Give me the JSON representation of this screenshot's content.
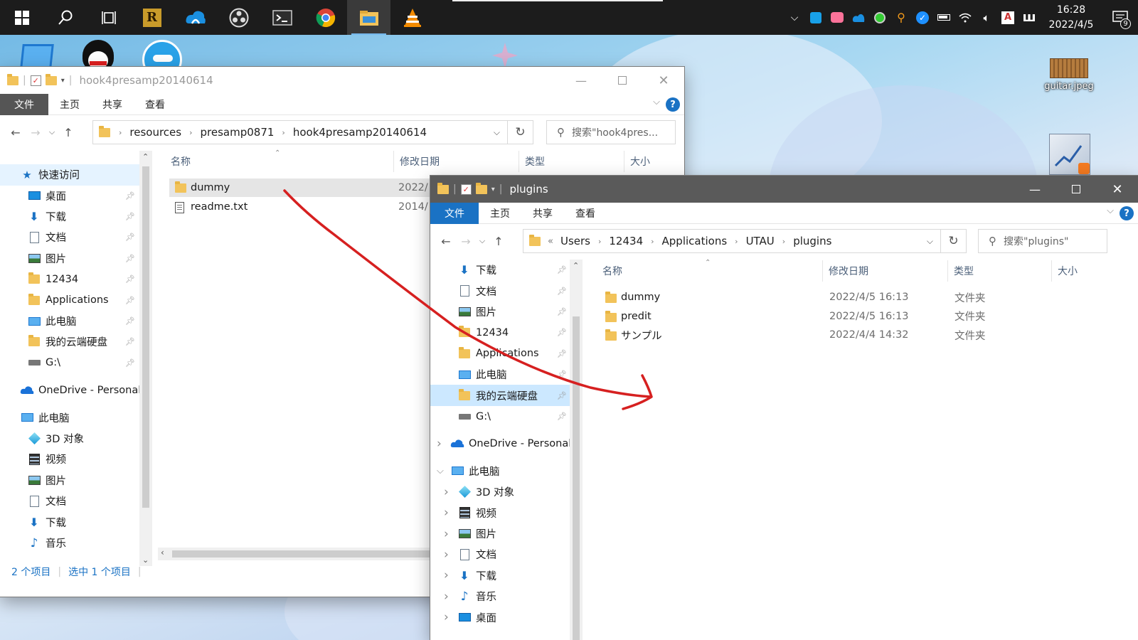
{
  "taskbar": {
    "apps": [
      {
        "name": "start",
        "icon": "windows-start-icon"
      },
      {
        "name": "search",
        "icon": "search-icon"
      },
      {
        "name": "task-view",
        "icon": "task-view-icon"
      },
      {
        "name": "r-app",
        "icon": "r-app-icon"
      },
      {
        "name": "cloud-app",
        "icon": "cloud-app-icon"
      },
      {
        "name": "obs",
        "icon": "obs-icon"
      },
      {
        "name": "terminal",
        "icon": "terminal-icon"
      },
      {
        "name": "chrome",
        "icon": "chrome-icon"
      },
      {
        "name": "file-explorer",
        "icon": "file-explorer-icon"
      },
      {
        "name": "vlc",
        "icon": "vlc-icon"
      }
    ],
    "clock_time": "16:28",
    "clock_date": "2022/4/5",
    "notif_count": "9"
  },
  "desktop": {
    "icons": [
      {
        "label": "guitar.jpeg"
      }
    ]
  },
  "window1": {
    "title": "hook4presamp20140614",
    "tabs": [
      "文件",
      "主页",
      "共享",
      "查看"
    ],
    "address": [
      "resources",
      "presamp0871",
      "hook4presamp20140614"
    ],
    "search_placeholder": "搜索\"hook4pres...",
    "nav": [
      {
        "label": "快速访问",
        "icon": "star-icon",
        "pinned": false
      },
      {
        "label": "桌面",
        "icon": "desktop-icon",
        "pinned": true
      },
      {
        "label": "下载",
        "icon": "download-icon",
        "pinned": true
      },
      {
        "label": "文档",
        "icon": "document-icon",
        "pinned": true
      },
      {
        "label": "图片",
        "icon": "pictures-icon",
        "pinned": true
      },
      {
        "label": "12434",
        "icon": "folder-icon",
        "pinned": true
      },
      {
        "label": "Applications",
        "icon": "folder-icon",
        "pinned": true
      },
      {
        "label": "此电脑",
        "icon": "computer-icon",
        "pinned": true
      },
      {
        "label": "我的云端硬盘",
        "icon": "folder-icon",
        "pinned": true
      },
      {
        "label": "G:\\",
        "icon": "drive-icon",
        "pinned": true
      },
      {
        "label": "OneDrive - Personal",
        "icon": "onedrive-icon",
        "pinned": false
      },
      {
        "label": "此电脑",
        "icon": "computer-icon",
        "pinned": false
      },
      {
        "label": "3D 对象",
        "icon": "3d-objects-icon",
        "pinned": false
      },
      {
        "label": "视频",
        "icon": "video-icon",
        "pinned": false
      },
      {
        "label": "图片",
        "icon": "pictures-icon",
        "pinned": false
      },
      {
        "label": "文档",
        "icon": "document-icon",
        "pinned": false
      },
      {
        "label": "下载",
        "icon": "download-icon",
        "pinned": false
      },
      {
        "label": "音乐",
        "icon": "music-icon",
        "pinned": false
      }
    ],
    "columns": [
      "名称",
      "修改日期",
      "类型",
      "大小"
    ],
    "files": [
      {
        "name": "dummy",
        "date": "2022/",
        "icon": "folder-icon",
        "selected": true
      },
      {
        "name": "readme.txt",
        "date": "2014/",
        "icon": "text-file-icon",
        "selected": false
      }
    ],
    "status_count": "2 个项目",
    "status_selected": "选中 1 个项目"
  },
  "window2": {
    "title": "plugins",
    "tabs": [
      "文件",
      "主页",
      "共享",
      "查看"
    ],
    "address_prefix": "«",
    "address": [
      "Users",
      "12434",
      "Applications",
      "UTAU",
      "plugins"
    ],
    "search_placeholder": "搜索\"plugins\"",
    "nav": [
      {
        "label": "下载",
        "icon": "download-icon",
        "pinned": true,
        "exp": ""
      },
      {
        "label": "文档",
        "icon": "document-icon",
        "pinned": true,
        "exp": ""
      },
      {
        "label": "图片",
        "icon": "pictures-icon",
        "pinned": true,
        "exp": ""
      },
      {
        "label": "12434",
        "icon": "folder-icon",
        "pinned": true,
        "exp": ""
      },
      {
        "label": "Applications",
        "icon": "folder-icon",
        "pinned": true,
        "exp": ""
      },
      {
        "label": "此电脑",
        "icon": "computer-icon",
        "pinned": true,
        "exp": ""
      },
      {
        "label": "我的云端硬盘",
        "icon": "folder-icon",
        "pinned": true,
        "exp": "",
        "selected": true
      },
      {
        "label": "G:\\",
        "icon": "drive-icon",
        "pinned": true,
        "exp": ""
      },
      {
        "label": "OneDrive - Personal",
        "icon": "onedrive-icon",
        "pinned": false,
        "exp": ">"
      },
      {
        "label": "此电脑",
        "icon": "computer-icon",
        "pinned": false,
        "exp": "v"
      },
      {
        "label": "3D 对象",
        "icon": "3d-objects-icon",
        "pinned": false,
        "exp": ">"
      },
      {
        "label": "视频",
        "icon": "video-icon",
        "pinned": false,
        "exp": ">"
      },
      {
        "label": "图片",
        "icon": "pictures-icon",
        "pinned": false,
        "exp": ">"
      },
      {
        "label": "文档",
        "icon": "document-icon",
        "pinned": false,
        "exp": ">"
      },
      {
        "label": "下载",
        "icon": "download-icon",
        "pinned": false,
        "exp": ">"
      },
      {
        "label": "音乐",
        "icon": "music-icon",
        "pinned": false,
        "exp": ">"
      },
      {
        "label": "桌面",
        "icon": "desktop-icon",
        "pinned": false,
        "exp": ">"
      }
    ],
    "columns": [
      "名称",
      "修改日期",
      "类型",
      "大小"
    ],
    "files": [
      {
        "name": "dummy",
        "date": "2022/4/5 16:13",
        "type": "文件夹"
      },
      {
        "name": "predit",
        "date": "2022/4/5 16:13",
        "type": "文件夹"
      },
      {
        "name": "サンプル",
        "date": "2022/4/4 14:32",
        "type": "文件夹"
      }
    ]
  },
  "annotation": {
    "color": "#d62020",
    "shape": "drag-arrow"
  }
}
